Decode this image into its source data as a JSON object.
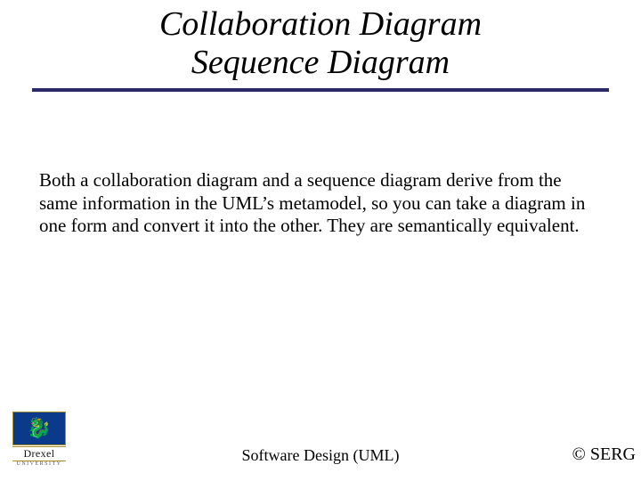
{
  "title": {
    "line1": "Collaboration Diagram",
    "line2": "Sequence Diagram"
  },
  "body": {
    "paragraph": "Both a  collaboration diagram and a sequence diagram derive from the same information in the UML’s metamodel, so you can take a diagram in one form and convert it into the other. They are semantically equivalent."
  },
  "footer": {
    "center": "Software Design (UML)",
    "right": "© SERG"
  },
  "logo": {
    "word": "Drexel",
    "sub": "UNIVERSITY"
  }
}
